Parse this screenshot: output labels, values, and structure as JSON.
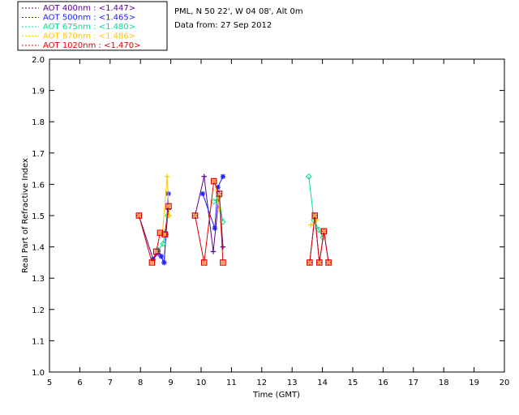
{
  "info": {
    "site": "PML, N 50 22', W 04 08', Alt 0m",
    "date": "Data from: 27 Sep 2012"
  },
  "colors": {
    "axis": "#000000",
    "background": "#ffffff"
  },
  "chart_data": {
    "type": "scatter",
    "xlabel": "Time (GMT)",
    "ylabel": "Real Part of Refractive Index",
    "xlim": [
      5,
      20
    ],
    "ylim": [
      1.0,
      2.0
    ],
    "xticks": [
      5,
      6,
      7,
      8,
      9,
      10,
      11,
      12,
      13,
      14,
      15,
      16,
      17,
      18,
      19,
      20
    ],
    "yticks": [
      1.0,
      1.1,
      1.2,
      1.3,
      1.4,
      1.5,
      1.6,
      1.7,
      1.8,
      1.9,
      2.0
    ],
    "ytick_labels": [
      "1.0",
      "1.1",
      "1.2",
      "1.3",
      "1.4",
      "1.5",
      "1.6",
      "1.7",
      "1.8",
      "1.9",
      "2.0"
    ],
    "legend_placement": "top-left outside",
    "series": [
      {
        "name": "AOT  400nm : <1.447>",
        "color": "#5a008c",
        "marker": "plus",
        "points": [
          [
            7.95,
            1.5
          ],
          [
            8.42,
            1.36
          ],
          [
            8.58,
            1.38
          ],
          [
            8.68,
            1.37
          ],
          [
            8.78,
            1.35
          ],
          [
            8.84,
            1.44
          ],
          [
            8.92,
            1.52
          ],
          [
            9.8,
            1.5
          ],
          [
            10.1,
            1.625
          ],
          [
            10.4,
            1.385
          ],
          [
            10.6,
            1.57
          ],
          [
            10.72,
            1.4
          ],
          [
            13.58,
            1.35
          ],
          [
            13.75,
            1.5
          ],
          [
            13.9,
            1.35
          ],
          [
            14.05,
            1.45
          ],
          [
            14.2,
            1.35
          ]
        ]
      },
      {
        "name": "AOT  500nm : <1.465>",
        "color": "#2020ff",
        "marker": "star",
        "points": [
          [
            8.42,
            1.36
          ],
          [
            8.58,
            1.385
          ],
          [
            8.68,
            1.37
          ],
          [
            8.78,
            1.35
          ],
          [
            8.84,
            1.44
          ],
          [
            8.92,
            1.57
          ],
          [
            10.05,
            1.57
          ],
          [
            10.45,
            1.46
          ],
          [
            10.55,
            1.59
          ],
          [
            10.72,
            1.625
          ]
        ]
      },
      {
        "name": "AOT  675nm : <1.480>",
        "color": "#00e08c",
        "marker": "diamond",
        "points": [
          [
            8.58,
            1.39
          ],
          [
            8.75,
            1.41
          ],
          [
            8.9,
            1.5
          ],
          [
            10.42,
            1.545
          ],
          [
            10.58,
            1.56
          ],
          [
            10.72,
            1.48
          ],
          [
            13.55,
            1.625
          ],
          [
            13.72,
            1.485
          ],
          [
            13.88,
            1.455
          ],
          [
            14.02,
            1.43
          ]
        ]
      },
      {
        "name": "AOT  870nm : <1.486>",
        "color": "#ffc800",
        "marker": "plus",
        "points": [
          [
            8.72,
            1.44
          ],
          [
            8.88,
            1.625
          ],
          [
            8.95,
            1.5
          ],
          [
            10.45,
            1.61
          ],
          [
            10.6,
            1.52
          ],
          [
            13.62,
            1.47
          ],
          [
            13.8,
            1.485
          ]
        ]
      },
      {
        "name": "AOT 1020nm : <1.470>",
        "color": "#e00000",
        "marker": "square",
        "points": [
          [
            7.95,
            1.5
          ],
          [
            8.38,
            1.35
          ],
          [
            8.52,
            1.385
          ],
          [
            8.65,
            1.445
          ],
          [
            8.8,
            1.44
          ],
          [
            8.93,
            1.53
          ],
          [
            9.8,
            1.5
          ],
          [
            10.1,
            1.35
          ],
          [
            10.42,
            1.61
          ],
          [
            10.6,
            1.57
          ],
          [
            10.72,
            1.35
          ],
          [
            13.58,
            1.35
          ],
          [
            13.75,
            1.5
          ],
          [
            13.9,
            1.35
          ],
          [
            14.05,
            1.45
          ],
          [
            14.2,
            1.35
          ]
        ]
      }
    ]
  }
}
